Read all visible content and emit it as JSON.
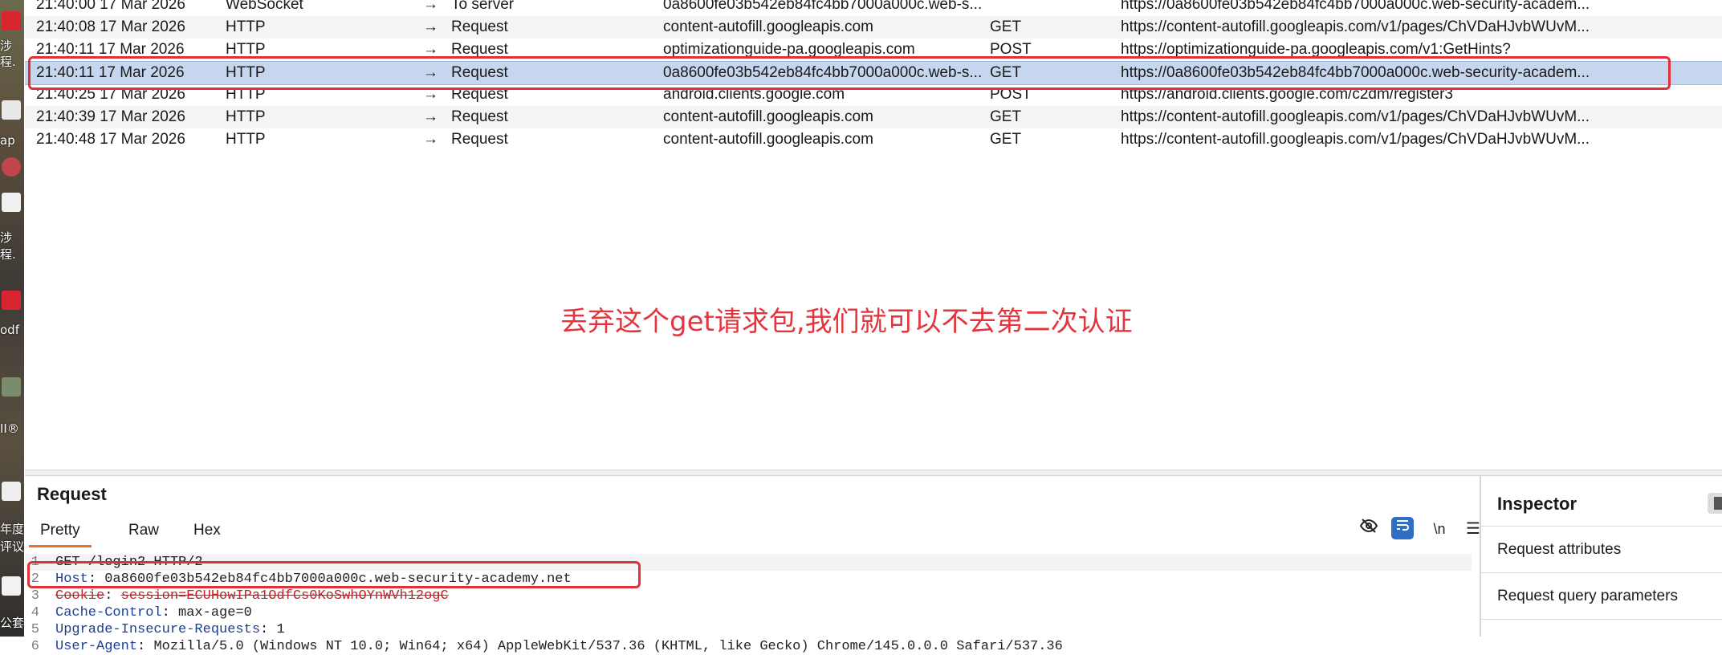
{
  "desktop": {
    "labels": [
      "涉",
      "程.",
      "ap",
      "涉",
      "程.",
      "odf",
      "II®",
      "年度i",
      "评议",
      "公套"
    ]
  },
  "history": {
    "rows": [
      {
        "time": "21:40:00 17 Mar 2026",
        "tool": "WebSocket",
        "dir": "→",
        "type": "To server",
        "host": "0a8600fe03b542eb84fc4bb7000a000c.web-s...",
        "method": "",
        "url": "https://0a8600fe03b542eb84fc4bb7000a000c.web-security-academ...",
        "extra": "",
        "selected": false
      },
      {
        "time": "21:40:08 17 Mar 2026",
        "tool": "HTTP",
        "dir": "→",
        "type": "Request",
        "host": "content-autofill.googleapis.com",
        "method": "GET",
        "url": "https://content-autofill.googleapis.com/v1/pages/ChVDaHJvbWUvM...",
        "extra": "",
        "selected": false
      },
      {
        "time": "21:40:11 17 Mar 2026",
        "tool": "HTTP",
        "dir": "→",
        "type": "Request",
        "host": "optimizationguide-pa.googleapis.com",
        "method": "POST",
        "url": "https://optimizationguide-pa.googleapis.com/v1:GetHints?",
        "extra": "",
        "selected": false
      },
      {
        "time": "21:40:11 17 Mar 2026",
        "tool": "HTTP",
        "dir": "→",
        "type": "Request",
        "host": "0a8600fe03b542eb84fc4bb7000a000c.web-s...",
        "method": "GET",
        "url": "https://0a8600fe03b542eb84fc4bb7000a000c.web-security-academ...",
        "extra": "",
        "selected": true
      },
      {
        "time": "21:40:25 17 Mar 2026",
        "tool": "HTTP",
        "dir": "→",
        "type": "Request",
        "host": "android.clients.google.com",
        "method": "POST",
        "url": "https://android.clients.google.com/c2dm/register3",
        "extra": "",
        "selected": false
      },
      {
        "time": "21:40:39 17 Mar 2026",
        "tool": "HTTP",
        "dir": "→",
        "type": "Request",
        "host": "content-autofill.googleapis.com",
        "method": "GET",
        "url": "https://content-autofill.googleapis.com/v1/pages/ChVDaHJvbWUvM...",
        "extra": "",
        "selected": false
      },
      {
        "time": "21:40:48 17 Mar 2026",
        "tool": "HTTP",
        "dir": "→",
        "type": "Request",
        "host": "content-autofill.googleapis.com",
        "method": "GET",
        "url": "https://content-autofill.googleapis.com/v1/pages/ChVDaHJvbWUvM...",
        "extra": "",
        "selected": false
      }
    ]
  },
  "annotation": {
    "text": "丢弃这个get请求包,我们就可以不去第二次认证",
    "color": "#e3353d"
  },
  "request_panel": {
    "title": "Request",
    "tabs": [
      "Pretty",
      "Raw",
      "Hex"
    ],
    "active_tab": "Pretty",
    "toolbar_icons": [
      "hide-eye-icon",
      "wrap-icon",
      "newline-icon",
      "menu-icon"
    ],
    "newline_label": "\\n",
    "lines": [
      {
        "num": "1",
        "key": "",
        "value": "GET /login2 HTTP/2"
      },
      {
        "num": "2",
        "key": "Host",
        "value": "0a8600fe03b542eb84fc4bb7000a000c.web-security-academy.net"
      },
      {
        "num": "3",
        "key": "Cookie",
        "value": "session=ECUHowIPa1OdfCs0KoSwhOYnWVh12ogC"
      },
      {
        "num": "4",
        "key": "Cache-Control",
        "value": "max-age=0"
      },
      {
        "num": "5",
        "key": "Upgrade-Insecure-Requests",
        "value": "1"
      },
      {
        "num": "6",
        "key": "User-Agent",
        "value": "Mozilla/5.0 (Windows NT 10.0; Win64; x64) AppleWebKit/537.36 (KHTML, like Gecko) Chrome/145.0.0.0 Safari/537.36"
      }
    ]
  },
  "inspector": {
    "title": "Inspector",
    "sections": [
      "Request attributes",
      "Request query parameters"
    ]
  },
  "colors": {
    "selection": "#c5d6ee",
    "highlight_box": "#e0303a",
    "accent": "#e8722c",
    "toggle_blue": "#2d6fc2"
  }
}
